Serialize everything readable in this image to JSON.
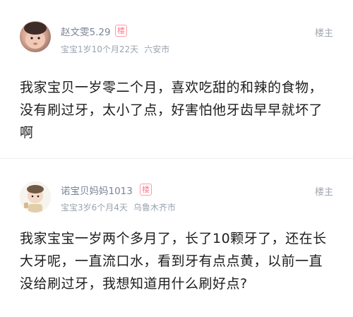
{
  "posts": [
    {
      "username": "赵文雯5.29",
      "op_badge": "楼",
      "baby_age": "宝宝1岁10个月22天",
      "location": "六安市",
      "floor_label": "楼主",
      "content": "我家宝贝一岁零二个月，喜欢吃甜的和辣的食物，没有刷过牙，太小了点，好害怕他牙齿早早就坏了啊",
      "avatar_icon": "baby-photo-avatar"
    },
    {
      "username": "诺宝贝妈妈1013",
      "op_badge": "楼",
      "baby_age": "宝宝3岁6个月4天",
      "location": "乌鲁木齐市",
      "floor_label": "楼主",
      "content": "我家宝宝一岁两个多月了，长了10颗牙了，还在长大牙呢，一直流口水，看到牙有点点黄，以前一直没给刷过牙，我想知道用什么刷好点?",
      "avatar_icon": "baby-photo-avatar"
    }
  ],
  "colors": {
    "username": "#7a8596",
    "meta": "#9aa3b0",
    "badge": "#ff7a8c",
    "content": "#1c1c1c"
  }
}
